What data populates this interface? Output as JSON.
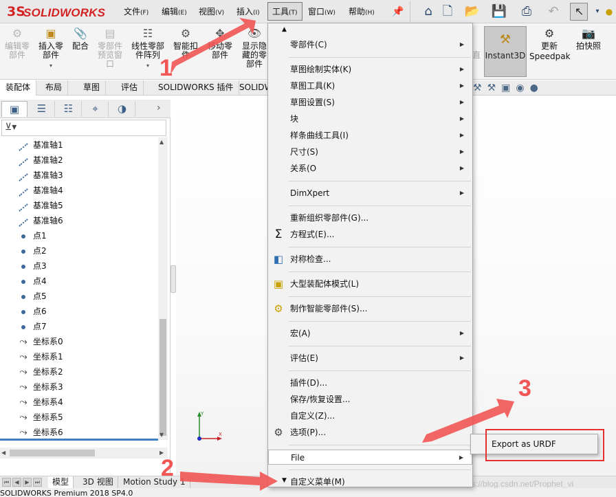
{
  "app": {
    "logo_mark": "3S",
    "logo_text": "SOLIDWORKS",
    "menu": [
      {
        "label": "文件",
        "key": "(F)"
      },
      {
        "label": "编辑",
        "key": "(E)"
      },
      {
        "label": "视图",
        "key": "(V)"
      },
      {
        "label": "插入",
        "key": "(I)"
      },
      {
        "label": "工具",
        "key": "(T)"
      },
      {
        "label": "窗口",
        "key": "(W)"
      },
      {
        "label": "帮助",
        "key": "(H)"
      }
    ]
  },
  "ribbon": {
    "edit_component": "编辑零部件",
    "insert_component": "插入零部件",
    "mate": "配合",
    "component_preview": "零部件预览窗口",
    "linear_pattern": "线性零部件阵列",
    "smart_fasteners": "智能扣件",
    "move_component": "移动零部件",
    "show_hidden": "显示隐藏的零部件",
    "instant3d": "Instant3D",
    "speedpak_line1": "更新",
    "speedpak_line2": "Speedpak",
    "snapshot": "拍快照",
    "cut_fragment": "直"
  },
  "cmd_tabs": [
    "装配体",
    "布局",
    "草图",
    "评估",
    "SOLIDWORKS 插件",
    "SOLIDW"
  ],
  "tree": [
    {
      "type": "axis",
      "label": "基准轴1"
    },
    {
      "type": "axis",
      "label": "基准轴2"
    },
    {
      "type": "axis",
      "label": "基准轴3"
    },
    {
      "type": "axis",
      "label": "基准轴4"
    },
    {
      "type": "axis",
      "label": "基准轴5"
    },
    {
      "type": "axis",
      "label": "基准轴6"
    },
    {
      "type": "point",
      "label": "点1"
    },
    {
      "type": "point",
      "label": "点2"
    },
    {
      "type": "point",
      "label": "点3"
    },
    {
      "type": "point",
      "label": "点4"
    },
    {
      "type": "point",
      "label": "点5"
    },
    {
      "type": "point",
      "label": "点6"
    },
    {
      "type": "point",
      "label": "点7"
    },
    {
      "type": "coord",
      "label": "坐标系0"
    },
    {
      "type": "coord",
      "label": "坐标系1"
    },
    {
      "type": "coord",
      "label": "坐标系2"
    },
    {
      "type": "coord",
      "label": "坐标系3"
    },
    {
      "type": "coord",
      "label": "坐标系4"
    },
    {
      "type": "coord",
      "label": "坐标系5"
    },
    {
      "type": "coord",
      "label": "坐标系6"
    }
  ],
  "tools_menu": [
    {
      "label": "零部件(C)",
      "submenu": true
    },
    {
      "sep": true
    },
    {
      "label": "草图绘制实体(K)",
      "submenu": true
    },
    {
      "label": "草图工具(K)",
      "submenu": true
    },
    {
      "label": "草图设置(S)",
      "submenu": true
    },
    {
      "label": "块",
      "submenu": true
    },
    {
      "label": "样条曲线工具(I)",
      "submenu": true
    },
    {
      "label": "尺寸(S)",
      "submenu": true
    },
    {
      "label": "关系(O",
      "submenu": true
    },
    {
      "sep": true
    },
    {
      "label": "DimXpert",
      "submenu": true
    },
    {
      "sep": true
    },
    {
      "label": "重新组织零部件(G)...",
      "submenu": false
    },
    {
      "label": "方程式(E)...",
      "submenu": false,
      "icon": "sigma-icon"
    },
    {
      "sep": true
    },
    {
      "label": "对称检查...",
      "submenu": false,
      "icon": "symmetry-icon"
    },
    {
      "sep": true
    },
    {
      "label": "大型装配体模式(L)",
      "submenu": false,
      "icon": "large-assembly-icon"
    },
    {
      "sep": true
    },
    {
      "label": "制作智能零部件(S)...",
      "submenu": false,
      "icon": "smart-component-icon"
    },
    {
      "sep": true
    },
    {
      "label": "宏(A)",
      "submenu": true
    },
    {
      "sep": true
    },
    {
      "label": "评估(E)",
      "submenu": true
    },
    {
      "sep": true
    },
    {
      "label": "插件(D)...",
      "submenu": false
    },
    {
      "label": "保存/恢复设置...",
      "submenu": false
    },
    {
      "label": "自定义(Z)...",
      "submenu": false
    },
    {
      "label": "选项(P)...",
      "submenu": false,
      "icon": "gear-icon"
    },
    {
      "sep": true
    },
    {
      "label": "File",
      "submenu": true,
      "highlight": true
    },
    {
      "sep": true
    },
    {
      "label": "自定义菜单(M)",
      "submenu": false
    }
  ],
  "file_submenu": {
    "export_label": "Export as URDF"
  },
  "bottom_tabs": [
    "模型",
    "3D 视图",
    "Motion Study 1"
  ],
  "status": {
    "text": "SOLIDWORKS Premium 2018 SP4.0"
  },
  "watermark": "https://blog.csdn.net/Prophet_vi",
  "annotations": {
    "n1": "1",
    "n2": "2",
    "n3": "3"
  },
  "colors": {
    "brand": "#d32323",
    "annotation": "#f25555",
    "highlight_box": "#e8312e"
  }
}
